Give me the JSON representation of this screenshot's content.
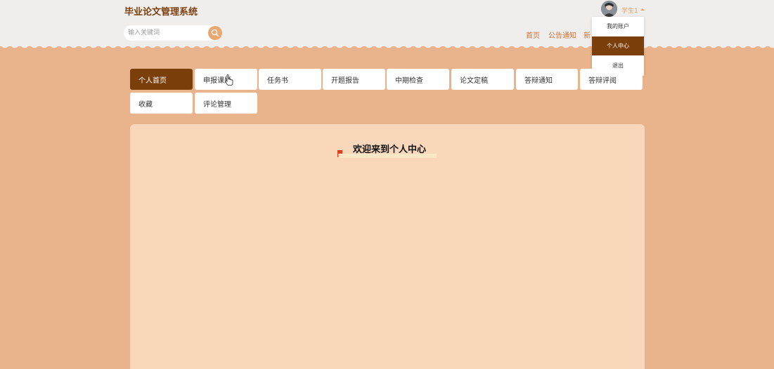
{
  "header": {
    "site_title": "毕业论文管理系统",
    "search_placeholder": "输入关键词",
    "search_icon": "search-icon",
    "nav": [
      "首页",
      "公告通知",
      "新"
    ],
    "user": {
      "name": "学生1",
      "dropdown": [
        "我的账户",
        "个人中心",
        "退出"
      ],
      "active_dropdown": "个人中心"
    }
  },
  "menu": {
    "items": [
      "个人首页",
      "申报课题",
      "任务书",
      "开题报告",
      "中期检查",
      "论文定稿",
      "答辩通知",
      "答辩评阅",
      "收藏",
      "评论管理"
    ],
    "active": "个人首页"
  },
  "content": {
    "welcome": "欢迎来到个人中心"
  },
  "colors": {
    "brand_dark": "#7b3f0b",
    "background": "#e9b48b",
    "panel": "#f8d7bb",
    "accent": "#e9a86f"
  }
}
